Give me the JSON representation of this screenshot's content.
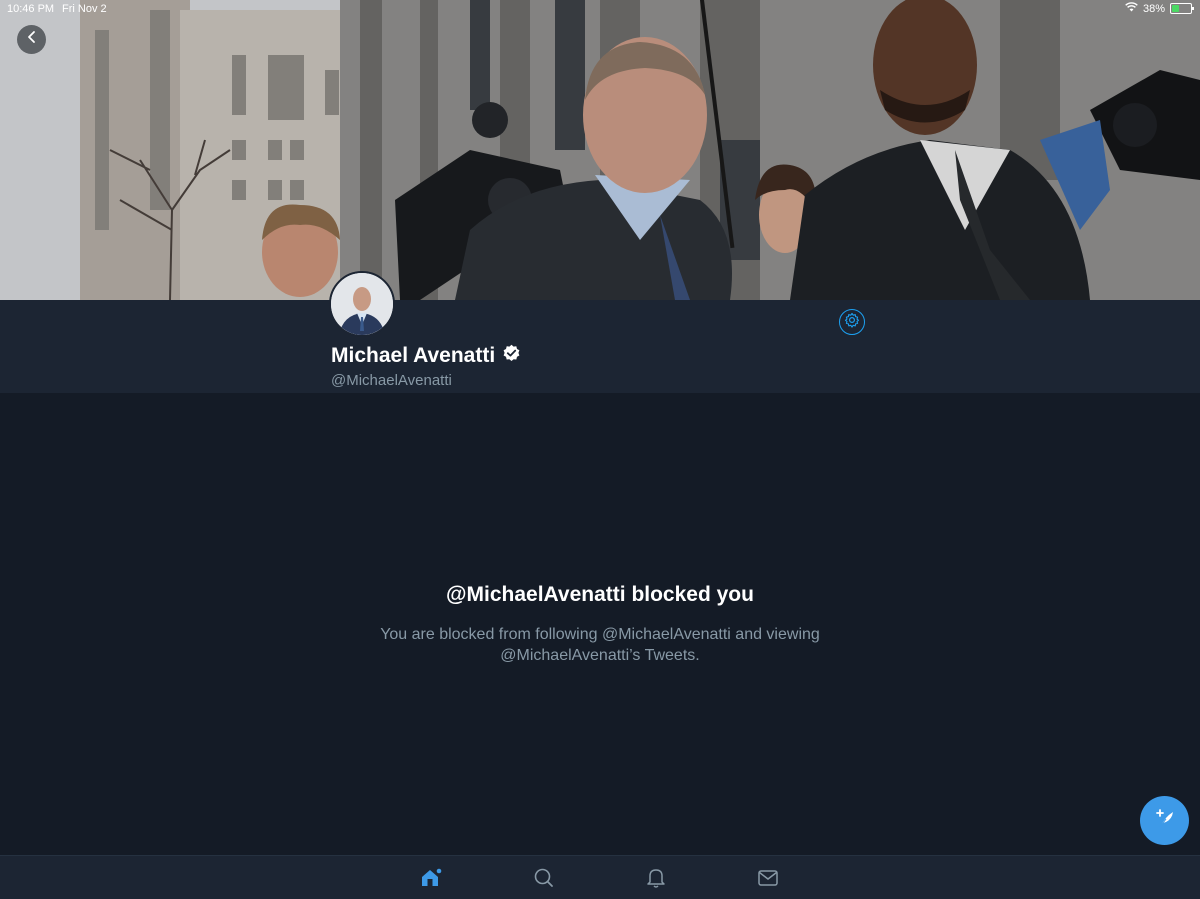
{
  "status_bar": {
    "time": "10:46 PM",
    "date": "Fri Nov 2",
    "battery_percent": "38%",
    "battery_level": 0.38
  },
  "header": {
    "back_icon": "chevron-left-icon"
  },
  "profile": {
    "display_name": "Michael Avenatti",
    "verified": true,
    "handle": "@MichaelAvenatti",
    "settings_icon": "gear-icon"
  },
  "blocked": {
    "title": "@MichaelAvenatti blocked you",
    "message_line1": "You are blocked from following @MichaelAvenatti and viewing",
    "message_line2": "@MichaelAvenatti’s Tweets."
  },
  "tabs": [
    {
      "name": "home",
      "icon": "home-icon",
      "active": true
    },
    {
      "name": "search",
      "icon": "search-icon",
      "active": false
    },
    {
      "name": "notifications",
      "icon": "bell-icon",
      "active": false
    },
    {
      "name": "messages",
      "icon": "mail-icon",
      "active": false
    }
  ],
  "colors": {
    "accent": "#1da1f2",
    "background": "#141b26",
    "header_bg": "#1c2533",
    "secondary_text": "#8899a6",
    "fab": "#3d9ae8"
  }
}
